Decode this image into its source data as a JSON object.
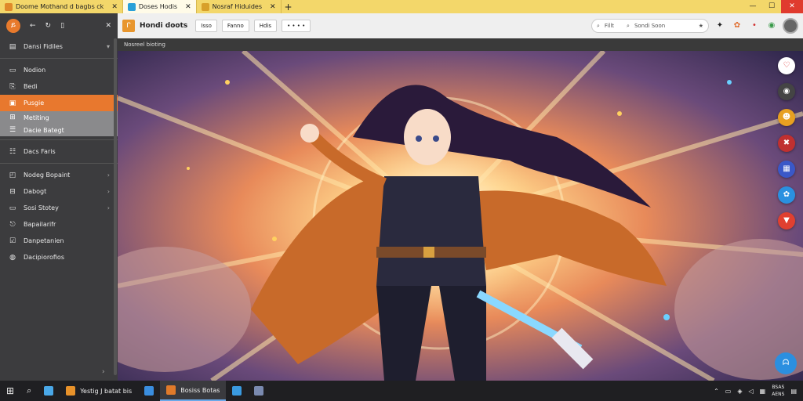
{
  "tabs": [
    {
      "label": "Doome Mothand d bagbs ck",
      "color": "#e08a2a",
      "active": false
    },
    {
      "label": "Doses Hodis",
      "color": "#2aa0d8",
      "active": true
    },
    {
      "label": "Nosraf Hiduides",
      "color": "#d8a02a",
      "active": false
    }
  ],
  "window": {
    "minimize": "—",
    "maximize": "☐",
    "close": "✕"
  },
  "sidebar": {
    "logo": "ይ",
    "items": [
      {
        "label": "Dansi Fidiles",
        "icon": "▤",
        "chevron": "▾"
      },
      {
        "label": "Nodion",
        "icon": "▭"
      },
      {
        "label": "Bedi",
        "icon": "⎘"
      },
      {
        "label": "Pusgie",
        "icon": "▣",
        "highlight": true
      },
      {
        "label": "Metiting",
        "icon": "⊞",
        "sub": true
      },
      {
        "label": "Dacie Bategt",
        "icon": "☰",
        "sub": true
      },
      {
        "label": "Dacs Faris",
        "icon": "☷"
      },
      {
        "label": "Nodeg Bopaint",
        "icon": "◰",
        "chevron": "›"
      },
      {
        "label": "Dabogt",
        "icon": "⊟",
        "chevron": "›"
      },
      {
        "label": "Sosi Stotey",
        "icon": "▭",
        "chevron": "›"
      },
      {
        "label": "Bapailarifr",
        "icon": "⎋"
      },
      {
        "label": "Danpetanien",
        "icon": "☑"
      },
      {
        "label": "Dacipiorofios",
        "icon": "◍"
      }
    ]
  },
  "toolbar": {
    "logo": "ᒋ",
    "title": "Hondi doots",
    "buttons": [
      "Isso",
      "Fanno",
      "Hdis",
      "• • • •"
    ],
    "search1": "Fillt",
    "search2": "Sondi Soon"
  },
  "content": {
    "header": "Nosreel bioting"
  },
  "fabs": [
    {
      "icon": "♡",
      "color": "#ffffff",
      "text": "#e03030"
    },
    {
      "icon": "◉",
      "color": "#444444",
      "text": "#ffffff"
    },
    {
      "icon": "☻",
      "color": "#e8a020",
      "text": "#ffffff"
    },
    {
      "icon": "✖",
      "color": "#c03030",
      "text": "#ffffff"
    },
    {
      "icon": "▦",
      "color": "#3a58c8",
      "text": "#ffffff"
    },
    {
      "icon": "✿",
      "color": "#2a90e0",
      "text": "#ffffff"
    },
    {
      "icon": "▼",
      "color": "#e04030",
      "text": "#ffffff"
    }
  ],
  "fab_main": "ᗣ",
  "taskbar": {
    "items": [
      {
        "label": "",
        "color": "#4aa8e8"
      },
      {
        "label": "Yestig J batat bis",
        "color": "#e8922a"
      },
      {
        "label": "",
        "color": "#3a8ee0"
      },
      {
        "label": "Bosiss Botas",
        "color": "#e07a2a",
        "active": true
      },
      {
        "label": "",
        "color": "#3a9ae0"
      },
      {
        "label": "",
        "color": "#7a8ab0"
      }
    ],
    "clock_line1": "BSAS",
    "clock_line2": "AENS"
  }
}
